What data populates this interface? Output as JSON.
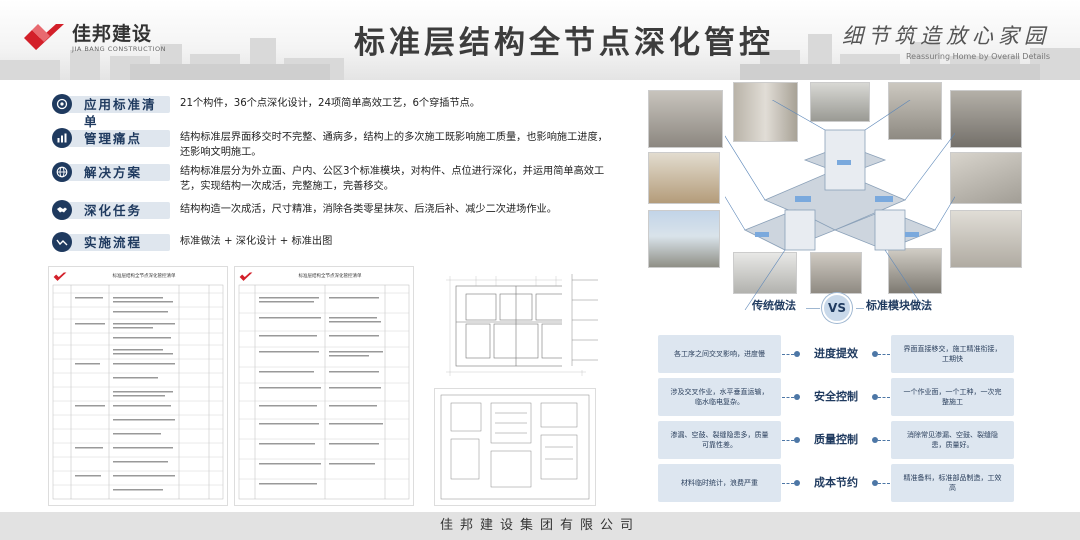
{
  "header": {
    "logo_cn": "佳邦建设",
    "logo_en": "JIA BANG CONSTRUCTION",
    "title": "标准层结构全节点深化管控",
    "slogan_cn": "细节筑造放心家园",
    "slogan_en": "Reassuring Home by Overall Details"
  },
  "items": [
    {
      "label": "应用标准清单",
      "icon": "target-icon",
      "text": "21个构件，36个点深化设计，24项简单高效工艺，6个穿插节点。"
    },
    {
      "label": "管理痛点",
      "icon": "bar-chart-icon",
      "text": "结构标准层界面移交时不完整、通病多，结构上的多次施工既影响施工质量，也影响施工进度，还影响文明施工。"
    },
    {
      "label": "解决方案",
      "icon": "globe-icon",
      "text": "结构标准层分为外立面、户内、公区3个标准模块，对构件、点位进行深化，并运用简单高效工艺，实现结构一次成活，完整施工，完善移交。"
    },
    {
      "label": "深化任务",
      "icon": "handshake-icon",
      "text": "结构构造一次成活，尺寸精准，消除各类零星抹灰、后浇后补、减少二次进场作业。"
    },
    {
      "label": "实施流程",
      "icon": "trend-icon",
      "text": "标准做法 + 深化设计 + 标准出图"
    }
  ],
  "documents": {
    "doc1_title": "标准层结构全节点深化管控清单",
    "doc2_title": "标准层结构全节点深化管控清单"
  },
  "comparison": {
    "left_head": "传统做法",
    "vs": "VS",
    "right_head": "标准模块做法",
    "rows": [
      {
        "left": "各工序之间交叉影响，进度慢",
        "mid": "进度提效",
        "right": "界面直接移交，施工精准衔接，工期快"
      },
      {
        "left": "涉及交叉作业，水平垂直运输，临水临电复杂。",
        "mid": "安全控制",
        "right": "一个作业面，一个工种，一次完整施工"
      },
      {
        "left": "渗漏、空鼓、裂缝隐患多，质量可靠性差。",
        "mid": "质量控制",
        "right": "消除常见渗漏、空鼓、裂缝隐患，质量好。"
      },
      {
        "left": "材料临时统计，浪费严重",
        "mid": "成本节约",
        "right": "精准备料，标准部品制造，工效高"
      }
    ]
  },
  "footer": {
    "company": "佳邦建设集团有限公司"
  },
  "colors": {
    "accent": "#1f3a5f",
    "brand_red": "#d3202a",
    "box": "#dde6f0"
  }
}
